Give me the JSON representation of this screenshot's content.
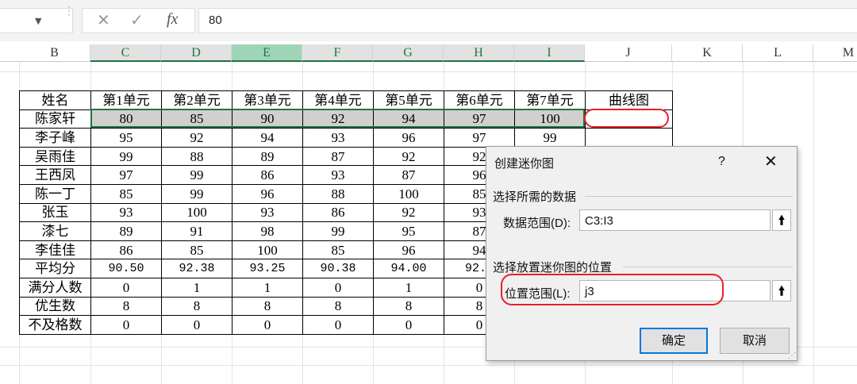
{
  "formula_bar": {
    "value": "80",
    "cancel_icon": "✕",
    "enter_icon": "✓",
    "fx_label": "fx",
    "namebox_arrow": "▼",
    "separator": "⋮"
  },
  "columns": [
    "B",
    "C",
    "D",
    "E",
    "F",
    "G",
    "H",
    "I",
    "J",
    "K",
    "L",
    "M"
  ],
  "table": {
    "headers": [
      "姓名",
      "第1单元",
      "第2单元",
      "第3单元",
      "第4单元",
      "第5单元",
      "第6单元",
      "第7单元",
      "曲线图"
    ],
    "rows": [
      [
        "陈家轩",
        "80",
        "85",
        "90",
        "92",
        "94",
        "97",
        "100",
        ""
      ],
      [
        "李子峰",
        "95",
        "92",
        "94",
        "93",
        "96",
        "97",
        "99",
        ""
      ],
      [
        "吴雨佳",
        "99",
        "88",
        "89",
        "87",
        "92",
        "92",
        "",
        ""
      ],
      [
        "王西凤",
        "97",
        "99",
        "86",
        "93",
        "87",
        "96",
        "",
        ""
      ],
      [
        "陈一丁",
        "85",
        "99",
        "96",
        "88",
        "100",
        "85",
        "",
        ""
      ],
      [
        "张玉",
        "93",
        "100",
        "93",
        "86",
        "92",
        "93",
        "",
        ""
      ],
      [
        "漆七",
        "89",
        "91",
        "98",
        "99",
        "95",
        "87",
        "",
        ""
      ],
      [
        "李佳佳",
        "86",
        "85",
        "100",
        "85",
        "96",
        "94",
        "",
        ""
      ],
      [
        "平均分",
        "90.50",
        "92.38",
        "93.25",
        "90.38",
        "94.00",
        "92.6",
        "",
        ""
      ],
      [
        "满分人数",
        "0",
        "1",
        "1",
        "0",
        "1",
        "0",
        "",
        ""
      ],
      [
        "优生数",
        "8",
        "8",
        "8",
        "8",
        "8",
        "8",
        "",
        ""
      ],
      [
        "不及格数",
        "0",
        "0",
        "0",
        "0",
        "0",
        "0",
        "",
        ""
      ]
    ]
  },
  "dialog": {
    "title": "创建迷你图",
    "help": "?",
    "close": "✕",
    "section_data": "选择所需的数据",
    "data_range_label": "数据范围(D):",
    "data_range_value": "C3:I3",
    "section_location": "选择放置迷你图的位置",
    "location_range_label": "位置范围(L):",
    "location_range_value": "j3",
    "collapse_icon": "🠙",
    "ok": "确定",
    "cancel": "取消",
    "grip": "⋰"
  },
  "colors": {
    "selection_green": "#217346",
    "annotation_red": "#e8202a",
    "selected_fill": "#d0d0d0"
  }
}
